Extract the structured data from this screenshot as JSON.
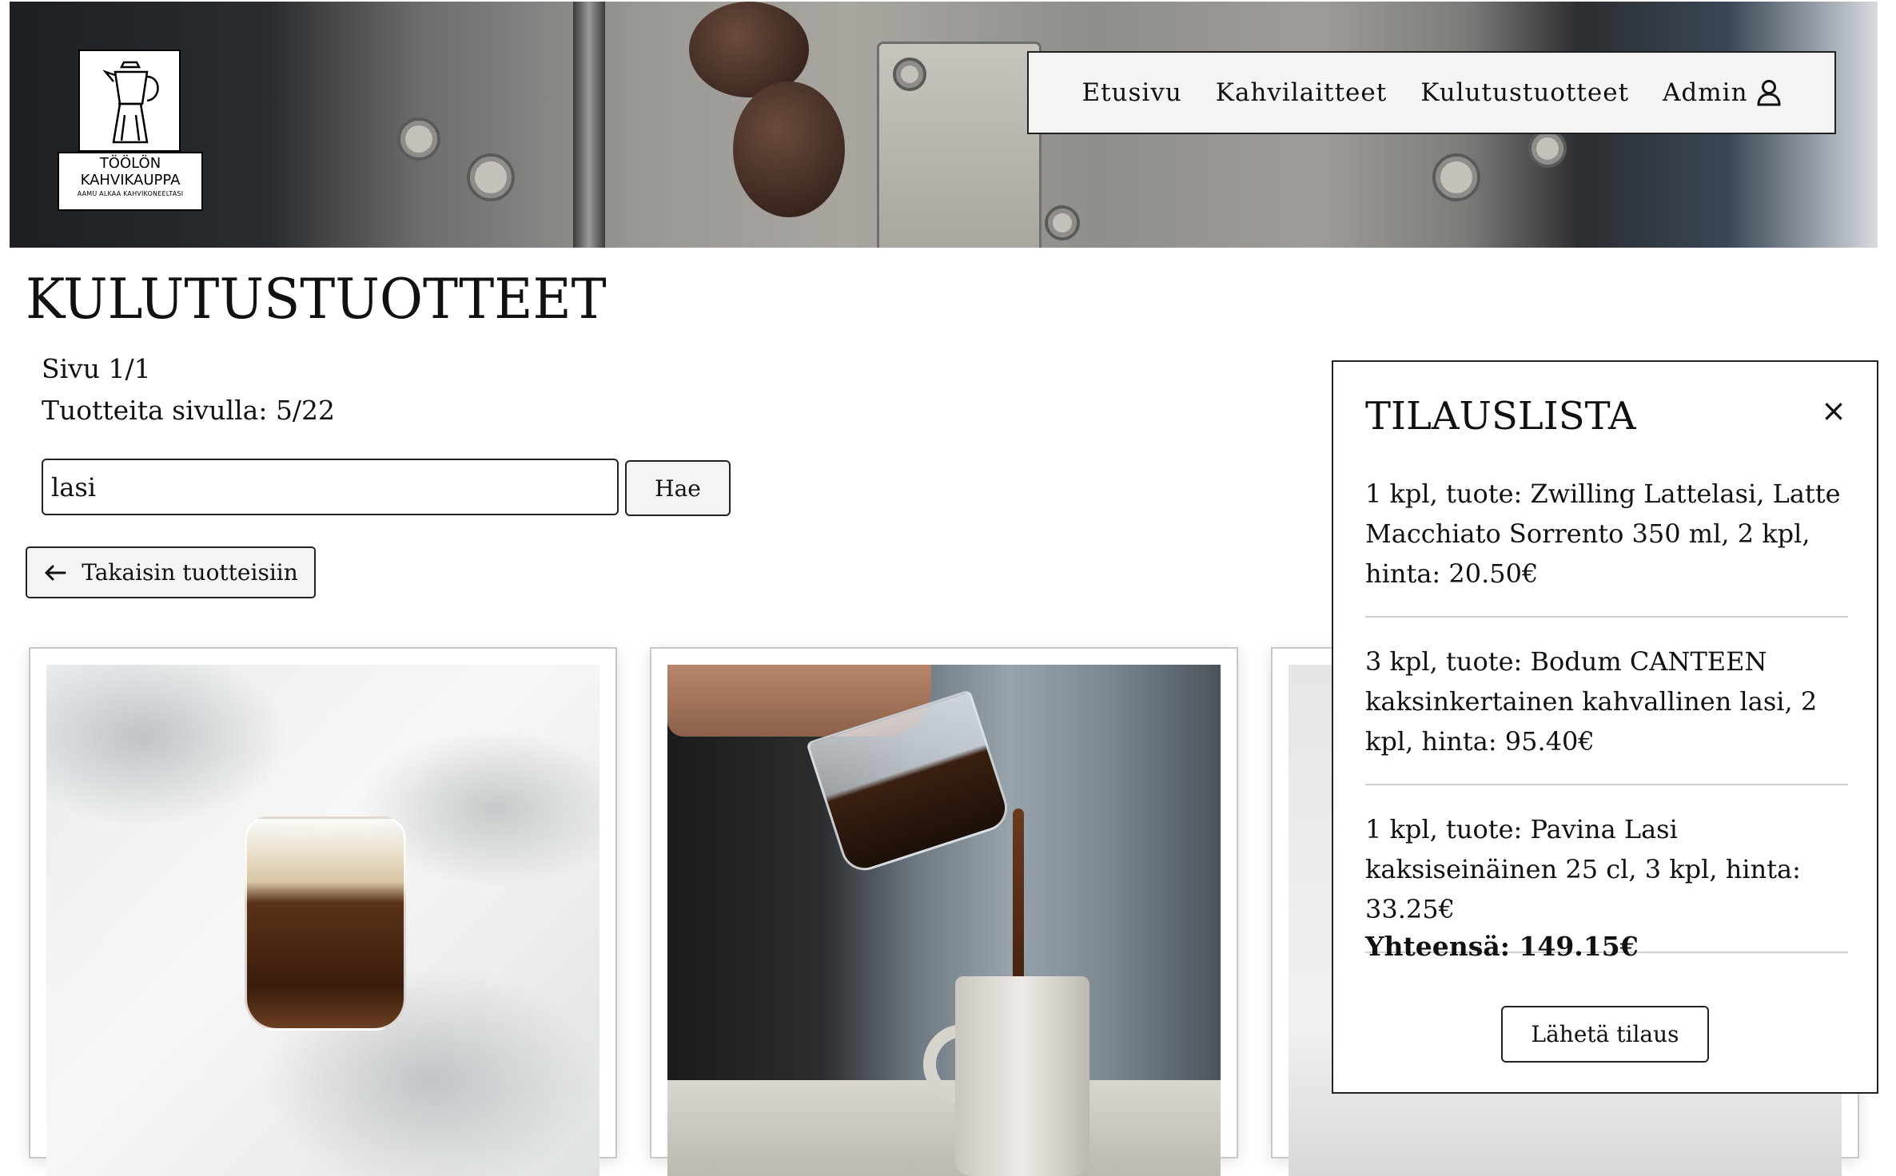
{
  "logo": {
    "line1": "TÖÖLÖN",
    "line2": "KAHVIKAUPPA",
    "line3": "AAMU ALKAA KAHVIKONEELTASI"
  },
  "nav": {
    "items": [
      {
        "label": "Etusivu"
      },
      {
        "label": "Kahvilaitteet"
      },
      {
        "label": "Kulutustuotteet"
      },
      {
        "label": "Admin",
        "icon": "user-icon"
      }
    ]
  },
  "page": {
    "title": "KULUTUSTUOTTEET",
    "page_info": "Sivu 1/1",
    "items_info": "Tuotteita sivulla: 5/22"
  },
  "search": {
    "value": "lasi",
    "button_label": "Hae"
  },
  "back_button": {
    "label": "Takaisin tuotteisiin",
    "icon": "arrow-left-icon"
  },
  "products": [
    {
      "image": "coffee-glass-photo"
    },
    {
      "image": "pouring-coffee-photo"
    },
    {
      "image": "iced-coffee-photo"
    }
  ],
  "order_list": {
    "title": "TILAUSLISTA",
    "close_icon": "×",
    "items": [
      {
        "text": "1 kpl, tuote: Zwilling Lattelasi, Latte Macchiato Sorrento 350 ml, 2 kpl, hinta: 20.50€"
      },
      {
        "text": "3 kpl, tuote: Bodum CANTEEN kaksinkertainen kahvallinen lasi, 2 kpl, hinta: 95.40€"
      },
      {
        "text": "1 kpl, tuote: Pavina Lasi kaksiseinäinen 25 cl, 3 kpl, hinta: 33.25€"
      }
    ],
    "total": "Yhteensä: 149.15€",
    "send_label": "Lähetä tilaus"
  }
}
